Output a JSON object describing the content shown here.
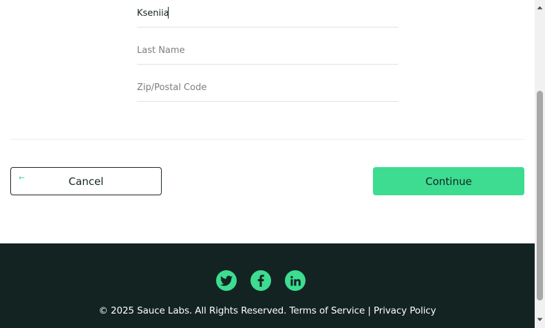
{
  "form": {
    "first_name_value": "Kseniia",
    "last_name_placeholder": "Last Name",
    "zip_placeholder": "Zip/Postal Code"
  },
  "actions": {
    "cancel_label": "Cancel",
    "continue_label": "Continue",
    "back_icon": "←"
  },
  "footer": {
    "social": [
      "twitter-icon",
      "facebook-icon",
      "linkedin-icon"
    ],
    "copyright": "© 2025 Sauce Labs. All Rights Reserved. Terms of Service | Privacy Policy"
  },
  "colors": {
    "accent": "#3ddc91",
    "dark": "#132322",
    "footer_bg": "#132322",
    "placeholder": "#7d7d7d"
  }
}
